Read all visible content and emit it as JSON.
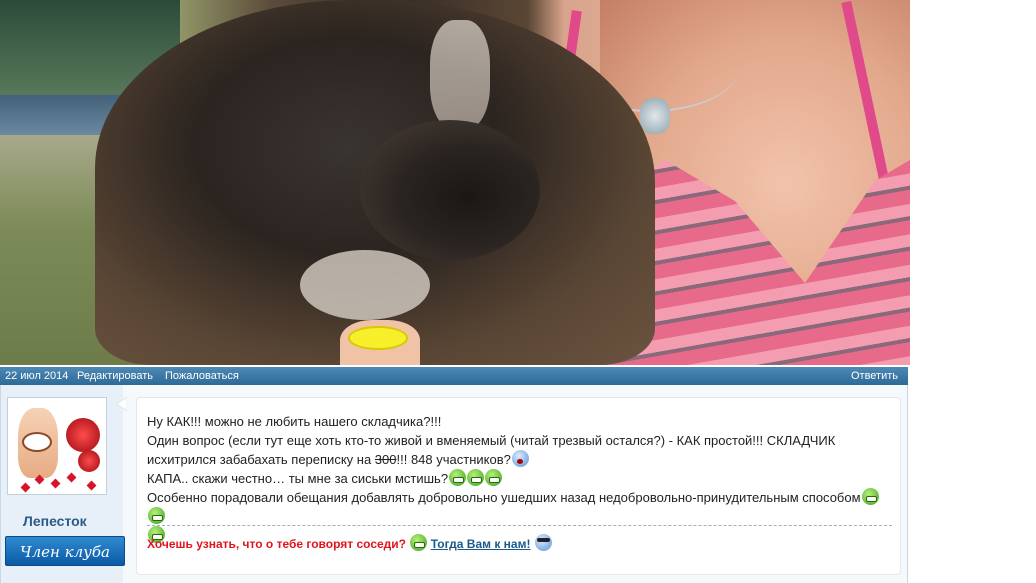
{
  "post": {
    "date": "22 июл 2014",
    "edit_label": "Редактировать",
    "report_label": "Пожаловаться",
    "reply_label": "Ответить"
  },
  "author": {
    "username": "Лепесток",
    "rank": "Член клуба"
  },
  "message": {
    "line1": "Ну КАК!!! можно не любить нашего складчика?!!!",
    "line2": "Один вопрос (если тут еще хоть кто-то живой и вменяемый (читай трезвый остался?) - КАК простой!!! СКЛАДЧИК",
    "line3_pre": "исхитрился забабахать переписку на ",
    "line3_strike": "300",
    "line3_post": "!!! 848 участников?",
    "line4": "КАПА.. скажи честно… ты мне за сиськи мстишь?",
    "line5": "Особенно порадовали обещания добавлять добровольно ушедших назад недобровольно-принудительным способом"
  },
  "signature": {
    "question": "Хочешь узнать, что о тебе говорят соседи?",
    "link": "Тогда Вам к нам!"
  },
  "colors": {
    "bar": "#2d6a98",
    "username": "#2a5a8a",
    "rank_bg": "#0b5aa6",
    "signature_question": "#e0141e",
    "signature_link": "#1a5a8a"
  },
  "icons": [
    "grin-smiley-icon",
    "shocked-smiley-icon",
    "cool-smiley-icon"
  ]
}
